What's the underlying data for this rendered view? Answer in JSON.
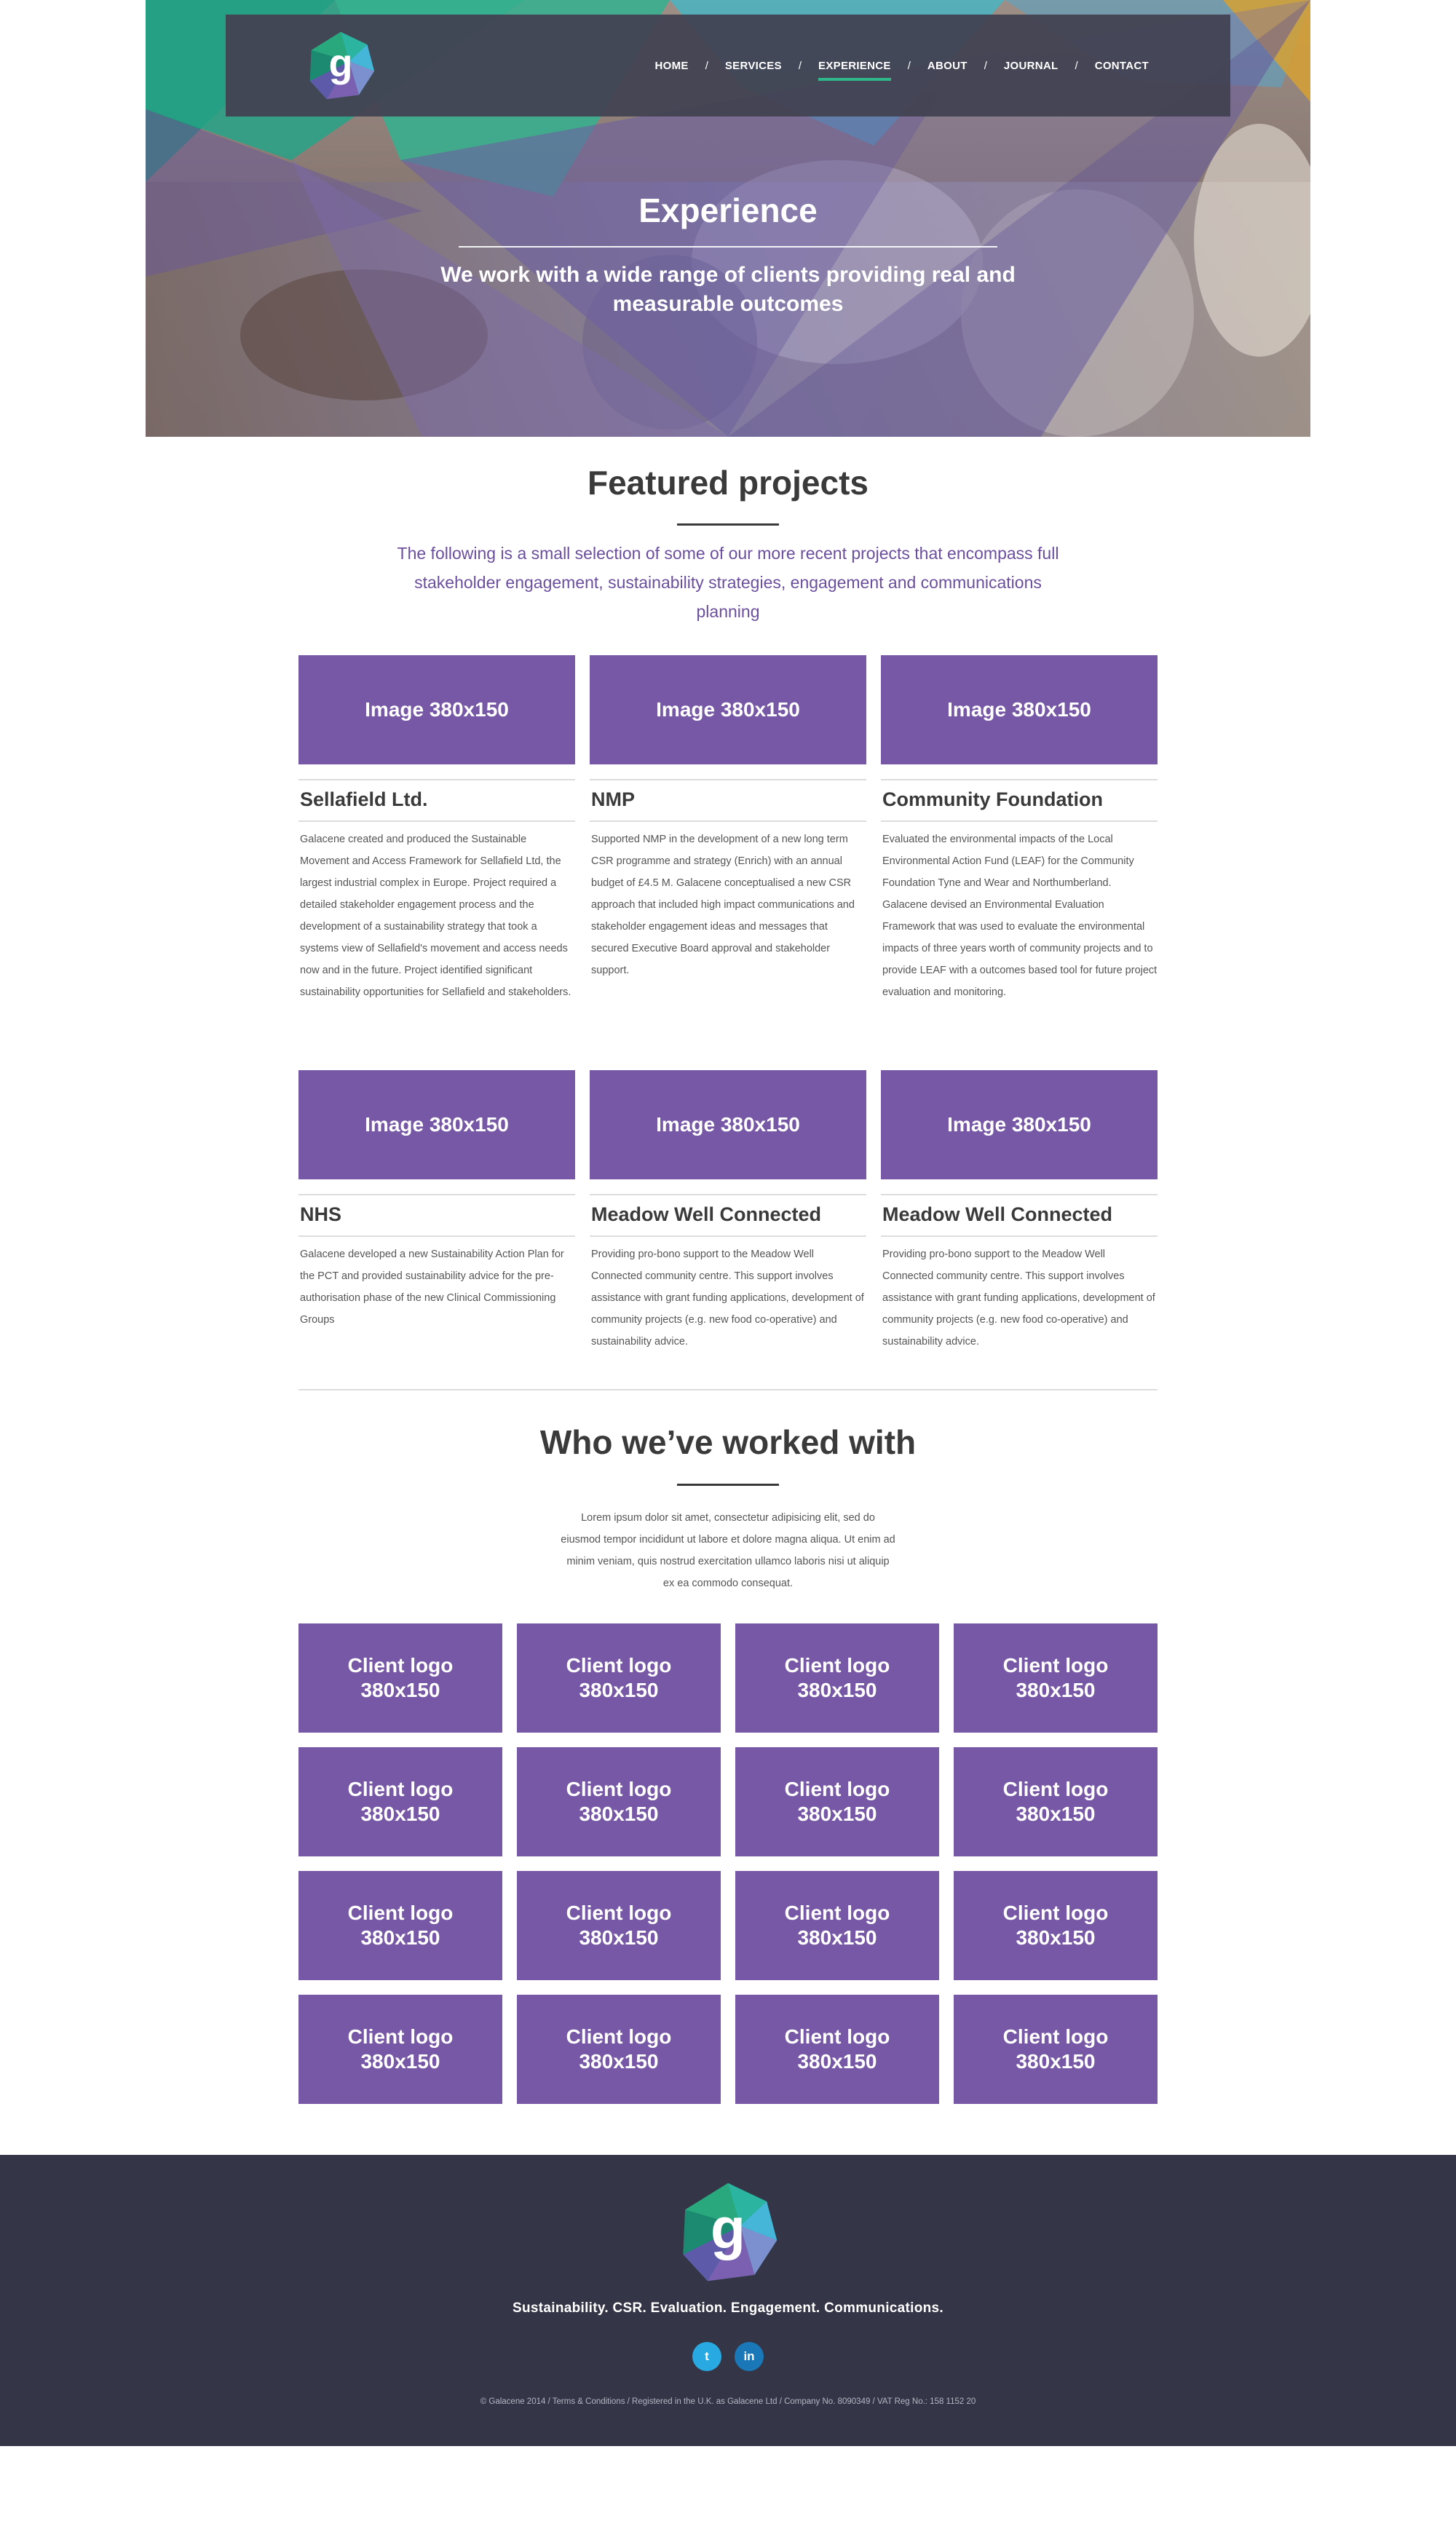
{
  "nav": {
    "items": [
      "HOME",
      "SERVICES",
      "EXPERIENCE",
      "ABOUT",
      "JOURNAL",
      "CONTACT"
    ],
    "separator": "/",
    "active": "EXPERIENCE"
  },
  "brand": {
    "logo_letter": "g",
    "logo_icon": "galacene-logo-icon"
  },
  "hero": {
    "title": "Experience",
    "subtitle": "We work with a wide range of clients providing real and measurable outcomes"
  },
  "featured": {
    "title": "Featured projects",
    "intro": "The following is a small selection of some of our more recent projects that encompass full stakeholder engagement, sustainability strategies, engagement and communications planning",
    "projects": [
      {
        "image_label": "Image 380x150",
        "title": "Sellafield Ltd.",
        "description": "Galacene created and produced the Sustainable Movement and Access Framework for Sellafield Ltd, the largest industrial complex in Europe. Project required a detailed stakeholder engagement process and the development of a sustainability strategy that took a systems view of Sellafield's movement and access needs now and in the future. Project identified significant sustainability opportunities for Sellafield and stakeholders."
      },
      {
        "image_label": "Image 380x150",
        "title": "NMP",
        "description": "Supported NMP in the development of a new long term CSR programme and strategy (Enrich) with an annual budget of £4.5 M. Galacene conceptualised a new CSR approach that included high impact communications and stakeholder engagement ideas and messages that secured Executive Board approval and stakeholder support."
      },
      {
        "image_label": "Image 380x150",
        "title": "Community Foundation",
        "description": "Evaluated the environmental impacts of the Local Environmental Action Fund (LEAF) for the Community Foundation Tyne and Wear and Northumberland. Galacene devised an Environmental Evaluation Framework that was used to evaluate the environmental impacts of three years worth of community projects and to provide LEAF with a outcomes based tool for future project evaluation and monitoring."
      },
      {
        "image_label": "Image 380x150",
        "title": "NHS",
        "description": "Galacene developed a new Sustainability Action Plan for the PCT and provided sustainability advice for the pre-authorisation phase of the new Clinical Commissioning Groups"
      },
      {
        "image_label": "Image 380x150",
        "title": "Meadow Well Connected",
        "description": "Providing pro-bono support to the Meadow Well Connected community centre. This support involves assistance with grant funding applications, development of community projects (e.g. new food co-operative) and sustainability advice."
      },
      {
        "image_label": "Image 380x150",
        "title": "Meadow Well Connected",
        "description": "Providing pro-bono support to the Meadow Well Connected community centre. This support involves assistance with grant funding applications, development of community projects (e.g. new food co-operative) and sustainability advice."
      }
    ]
  },
  "clients": {
    "title": "Who we’ve worked with",
    "intro": "Lorem ipsum dolor sit amet, consectetur adipisicing elit, sed do eiusmod tempor incididunt ut labore et dolore magna aliqua. Ut enim ad minim veniam, quis nostrud exercitation ullamco laboris nisi ut aliquip ex ea commodo consequat.",
    "logo_line1": "Client logo",
    "logo_line2": "380x150",
    "count": 16
  },
  "footer": {
    "tagline": "Sustainability. CSR. Evaluation. Engagement. Communications.",
    "social": [
      {
        "name": "twitter",
        "icon": "twitter-icon",
        "glyph": "t"
      },
      {
        "name": "linkedin",
        "icon": "linkedin-icon",
        "glyph": "in"
      }
    ],
    "legal": "© Galacene 2014  /  Terms & Conditions /  Registered in the U.K. as Galacene Ltd  /  Company No. 8090349 / VAT Reg No.: 158 1152 20"
  },
  "colors": {
    "accent_purple": "#7758a6",
    "intro_purple": "#6b4f9e",
    "nav_bg": "#424252",
    "footer_bg": "#343546",
    "active_underline": "#2fb889",
    "twitter": "#29a9e1",
    "linkedin": "#1a78b8"
  }
}
